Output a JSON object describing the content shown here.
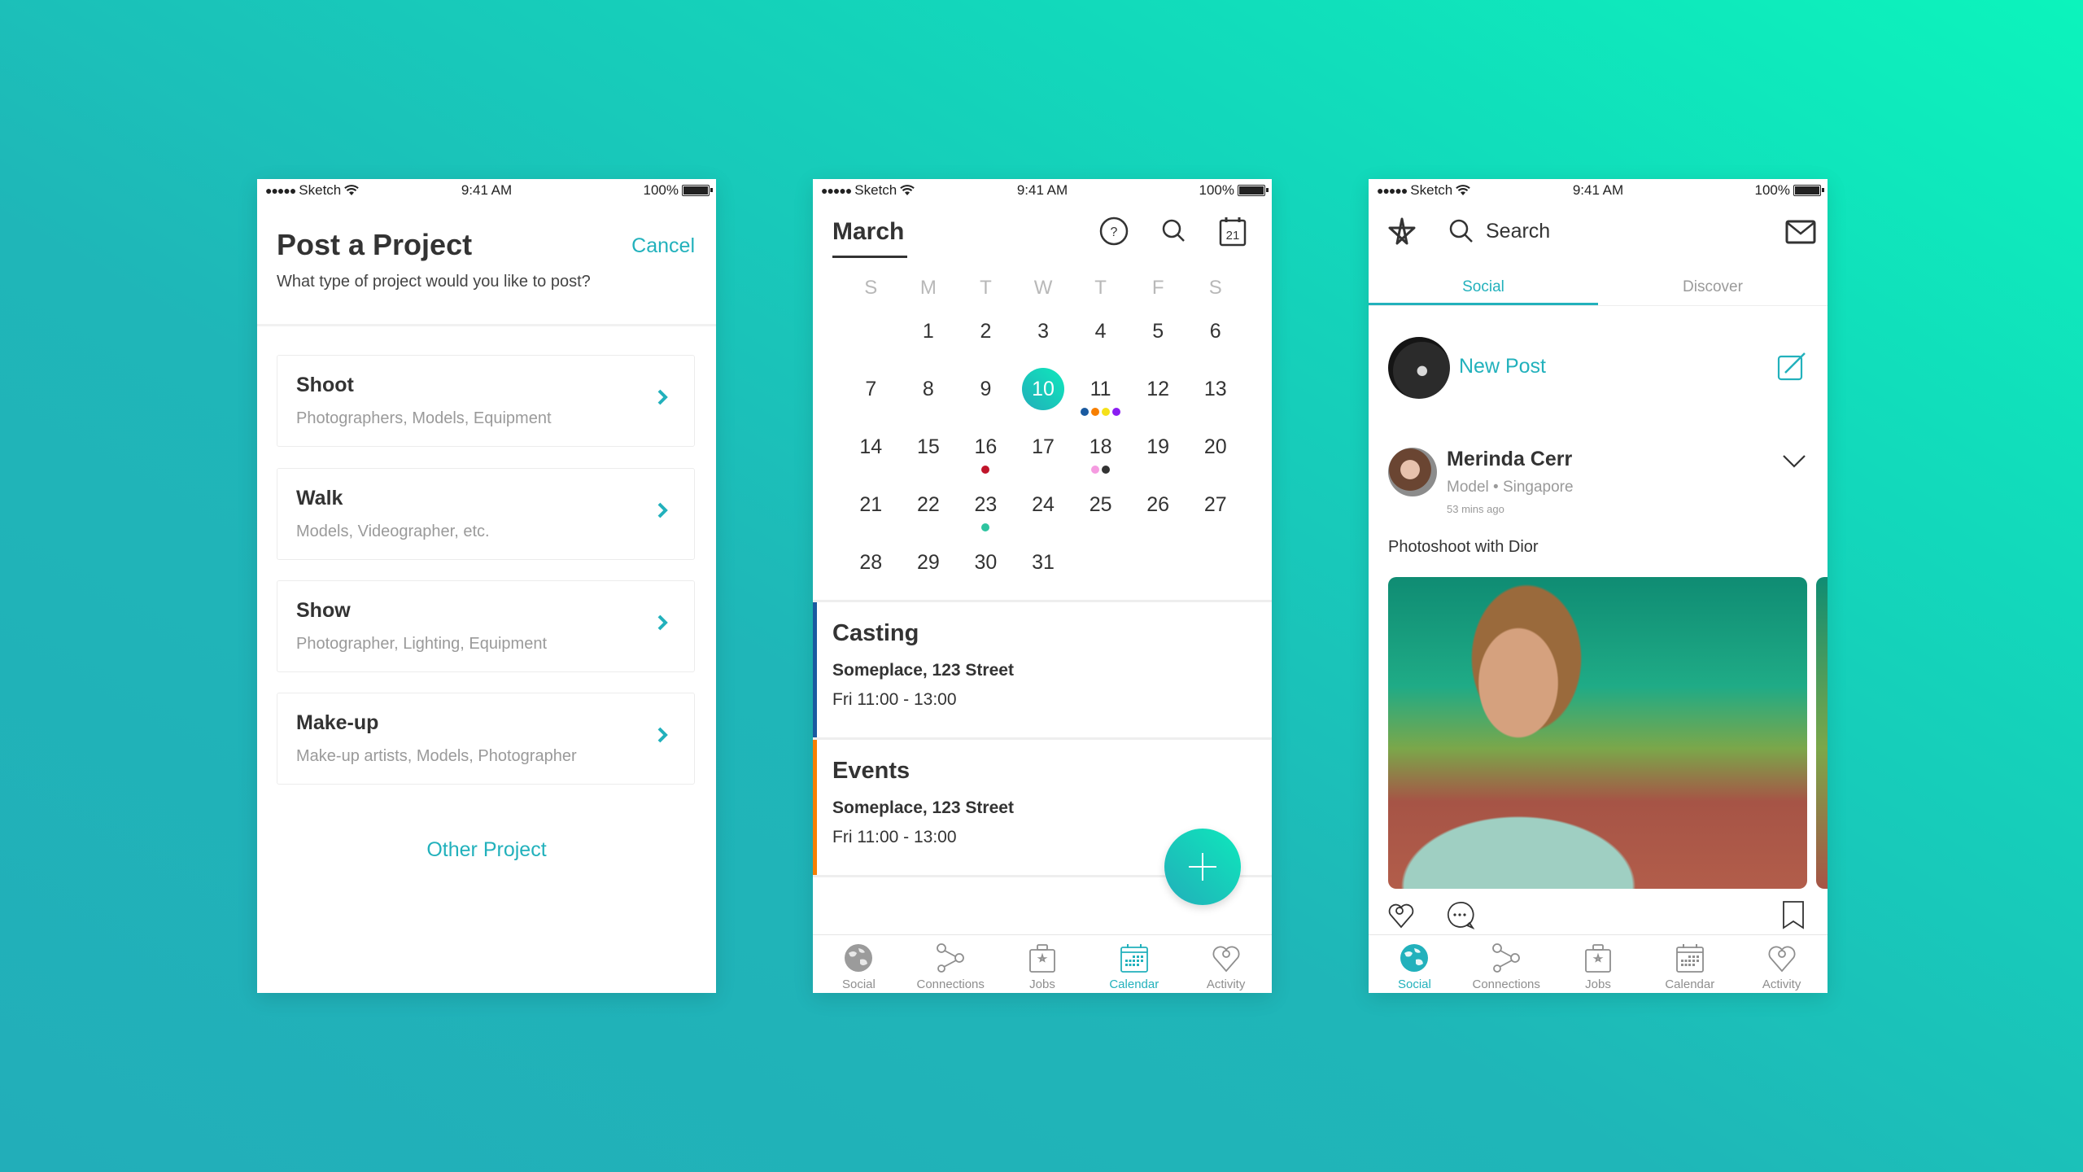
{
  "colors": {
    "accent": "#22b1bc",
    "background_start": "#22aeb9",
    "background_end": "#0cf4bc",
    "text_dark": "#333333",
    "text_muted": "#9a9a9a"
  },
  "status_bar": {
    "carrier": "Sketch",
    "signal_dots": "●●●●●",
    "time": "9:41 AM",
    "battery": "100%"
  },
  "post_project": {
    "title": "Post a Project",
    "cancel_label": "Cancel",
    "subtitle": "What type of project would you like to post?",
    "options": [
      {
        "title": "Shoot",
        "subtitle": "Photographers, Models, Equipment"
      },
      {
        "title": "Walk",
        "subtitle": "Models, Videographer, etc."
      },
      {
        "title": "Show",
        "subtitle": "Photographer, Lighting, Equipment"
      },
      {
        "title": "Make-up",
        "subtitle": "Make-up artists, Models, Photographer"
      }
    ],
    "other_label": "Other Project"
  },
  "calendar": {
    "month": "March",
    "calendar_icon_day": "21",
    "weekdays": [
      "S",
      "M",
      "T",
      "W",
      "T",
      "F",
      "S"
    ],
    "weeks": [
      [
        "",
        "1",
        "2",
        "3",
        "4",
        "5",
        "6"
      ],
      [
        "7",
        "8",
        "9",
        "10",
        "11",
        "12",
        "13"
      ],
      [
        "14",
        "15",
        "16",
        "17",
        "18",
        "19",
        "20"
      ],
      [
        "21",
        "22",
        "23",
        "24",
        "25",
        "26",
        "27"
      ],
      [
        "28",
        "29",
        "30",
        "31",
        "",
        "",
        ""
      ]
    ],
    "selected_day": "10",
    "event_dots": {
      "11": [
        "#1a5aa0",
        "#f77f00",
        "#f5e11a",
        "#8a1ef2"
      ],
      "16": [
        "#c0142a"
      ],
      "18": [
        "#f59be0",
        "#333333"
      ],
      "23": [
        "#2ec4a0"
      ]
    },
    "events": [
      {
        "title": "Casting",
        "place": "Someplace, 123 Street",
        "time": "Fri 11:00 - 13:00",
        "color": "#1a5aa0"
      },
      {
        "title": "Events",
        "place": "Someplace, 123 Street",
        "time": "Fri 11:00 - 13:00",
        "color": "#f77f00"
      }
    ],
    "fab_icon": "plus-icon"
  },
  "tabbar": {
    "items": [
      {
        "label": "Social",
        "icon": "globe-icon"
      },
      {
        "label": "Connections",
        "icon": "share-nodes-icon"
      },
      {
        "label": "Jobs",
        "icon": "briefcase-star-icon"
      },
      {
        "label": "Calendar",
        "icon": "calendar-icon"
      },
      {
        "label": "Activity",
        "icon": "heart-icon"
      }
    ]
  },
  "social": {
    "search_label": "Search",
    "tabs": [
      {
        "label": "Social",
        "active": true
      },
      {
        "label": "Discover",
        "active": false
      }
    ],
    "new_post_label": "New Post",
    "post": {
      "author": "Merinda Cerr",
      "meta": "Model • Singapore",
      "time": "53 mins ago",
      "text": "Photoshoot with Dior"
    }
  }
}
